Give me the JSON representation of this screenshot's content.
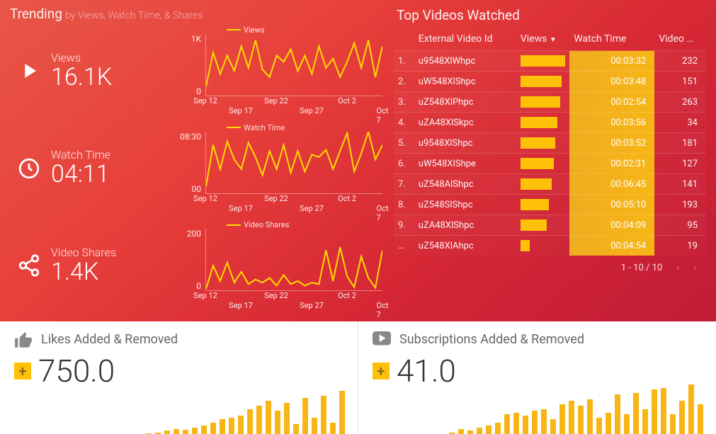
{
  "trending": {
    "title": "Trending",
    "subtitle": "by Views, Watch Time, & Shares",
    "stats": [
      {
        "label": "Views",
        "value": "16.1K"
      },
      {
        "label": "Watch Time",
        "value": "04:11"
      },
      {
        "label": "Video Shares",
        "value": "1.4K"
      }
    ]
  },
  "chart_data": [
    {
      "type": "line",
      "title": "Views",
      "ylim": [
        0,
        1000
      ],
      "yticks": [
        "1K",
        "0"
      ],
      "x": [
        "Sep 12",
        "Sep 13",
        "Sep 14",
        "Sep 15",
        "Sep 16",
        "Sep 17",
        "Sep 18",
        "Sep 19",
        "Sep 20",
        "Sep 21",
        "Sep 22",
        "Sep 23",
        "Sep 24",
        "Sep 25",
        "Sep 26",
        "Sep 27",
        "Sep 28",
        "Sep 29",
        "Sep 30",
        "Oct 1",
        "Oct 2",
        "Oct 3",
        "Oct 4",
        "Oct 5",
        "Oct 6",
        "Oct 7"
      ],
      "values": [
        150,
        700,
        350,
        650,
        400,
        800,
        450,
        900,
        420,
        300,
        650,
        550,
        750,
        400,
        650,
        350,
        800,
        450,
        600,
        300,
        550,
        850,
        450,
        900,
        300,
        800
      ],
      "xticks": [
        "Sep 12",
        "Sep 17",
        "Sep 22",
        "Sep 27",
        "Oct 2",
        "Oct 7"
      ]
    },
    {
      "type": "line",
      "title": "Watch Time",
      "ylim": [
        0,
        510
      ],
      "yticks": [
        "08:30",
        "00"
      ],
      "x": [
        "Sep 12",
        "Sep 13",
        "Sep 14",
        "Sep 15",
        "Sep 16",
        "Sep 17",
        "Sep 18",
        "Sep 19",
        "Sep 20",
        "Sep 21",
        "Sep 22",
        "Sep 23",
        "Sep 24",
        "Sep 25",
        "Sep 26",
        "Sep 27",
        "Sep 28",
        "Sep 29",
        "Sep 30",
        "Oct 1",
        "Oct 2",
        "Oct 3",
        "Oct 4",
        "Oct 5",
        "Oct 6",
        "Oct 7"
      ],
      "values": [
        60,
        400,
        200,
        430,
        280,
        200,
        420,
        300,
        150,
        350,
        200,
        400,
        170,
        350,
        180,
        320,
        300,
        360,
        200,
        350,
        500,
        180,
        330,
        510,
        280,
        400
      ],
      "xticks": [
        "Sep 12",
        "Sep 17",
        "Sep 22",
        "Sep 27",
        "Oct 2",
        "Oct 7"
      ]
    },
    {
      "type": "line",
      "title": "Video Shares",
      "ylim": [
        0,
        200
      ],
      "yticks": [
        "200",
        "0"
      ],
      "x": [
        "Sep 12",
        "Sep 13",
        "Sep 14",
        "Sep 15",
        "Sep 16",
        "Sep 17",
        "Sep 18",
        "Sep 19",
        "Sep 20",
        "Sep 21",
        "Sep 22",
        "Sep 23",
        "Sep 24",
        "Sep 25",
        "Sep 26",
        "Sep 27",
        "Sep 28",
        "Sep 29",
        "Sep 30",
        "Oct 1",
        "Oct 2",
        "Oct 3",
        "Oct 4",
        "Oct 5",
        "Oct 6",
        "Oct 7"
      ],
      "values": [
        5,
        80,
        30,
        90,
        25,
        60,
        20,
        35,
        25,
        40,
        15,
        50,
        20,
        30,
        15,
        25,
        20,
        130,
        30,
        140,
        45,
        10,
        110,
        40,
        8,
        130
      ],
      "xticks": [
        "Sep 12",
        "Sep 17",
        "Sep 22",
        "Sep 27",
        "Oct 2",
        "Oct 7"
      ]
    },
    {
      "type": "bar",
      "title": "Likes Added & Removed",
      "values": [
        1,
        2,
        4,
        6,
        5,
        8,
        10,
        14,
        18,
        20,
        22,
        30,
        34,
        40,
        28,
        38,
        12,
        44,
        20,
        46,
        14,
        52
      ],
      "ylim": [
        0,
        60
      ]
    },
    {
      "type": "bar",
      "title": "Subscriptions Added & Removed",
      "values": [
        2,
        6,
        4,
        8,
        10,
        14,
        24,
        26,
        22,
        28,
        30,
        18,
        36,
        40,
        34,
        42,
        20,
        26,
        48,
        24,
        50,
        30,
        54,
        56,
        24,
        40,
        60,
        36
      ],
      "ylim": [
        0,
        60
      ]
    }
  ],
  "table": {
    "title": "Top Videos Watched",
    "headers": [
      "External Video Id",
      "Views",
      "Watch Time",
      "Video …"
    ],
    "sort_col": 1,
    "rows": [
      {
        "n": "1.",
        "id": "u9548XlWhpc",
        "views_pct": 100,
        "wt": "00:03:32",
        "vc": "232"
      },
      {
        "n": "2.",
        "id": "uW548XlShpc",
        "views_pct": 92,
        "wt": "00:03:48",
        "vc": "151"
      },
      {
        "n": "3.",
        "id": "uZ548XlPhpc",
        "views_pct": 88,
        "wt": "00:02:54",
        "vc": "263"
      },
      {
        "n": "4.",
        "id": "uZA48XlSkpc",
        "views_pct": 82,
        "wt": "00:03:56",
        "vc": "34"
      },
      {
        "n": "5.",
        "id": "u9548XlShpc",
        "views_pct": 78,
        "wt": "00:03:52",
        "vc": "181"
      },
      {
        "n": "6.",
        "id": "uW548XlShpe",
        "views_pct": 74,
        "wt": "00:02:31",
        "vc": "127"
      },
      {
        "n": "7.",
        "id": "uZ548AlShpc",
        "views_pct": 70,
        "wt": "00:06:45",
        "vc": "141"
      },
      {
        "n": "8.",
        "id": "uZ548SlShpc",
        "views_pct": 64,
        "wt": "00:05:10",
        "vc": "193"
      },
      {
        "n": "9.",
        "id": "uZA48XlShpc",
        "views_pct": 58,
        "wt": "00:04:09",
        "vc": "95"
      },
      {
        "n": "…",
        "id": "uZ548XlAhpc",
        "views_pct": 20,
        "wt": "00:04:54",
        "vc": "19"
      }
    ],
    "pager": "1 - 10 / 10"
  },
  "bottom": {
    "likes": {
      "title": "Likes Added & Removed",
      "value": "750.0"
    },
    "subs": {
      "title": "Subscriptions Added & Removed",
      "value": "41.0"
    }
  }
}
